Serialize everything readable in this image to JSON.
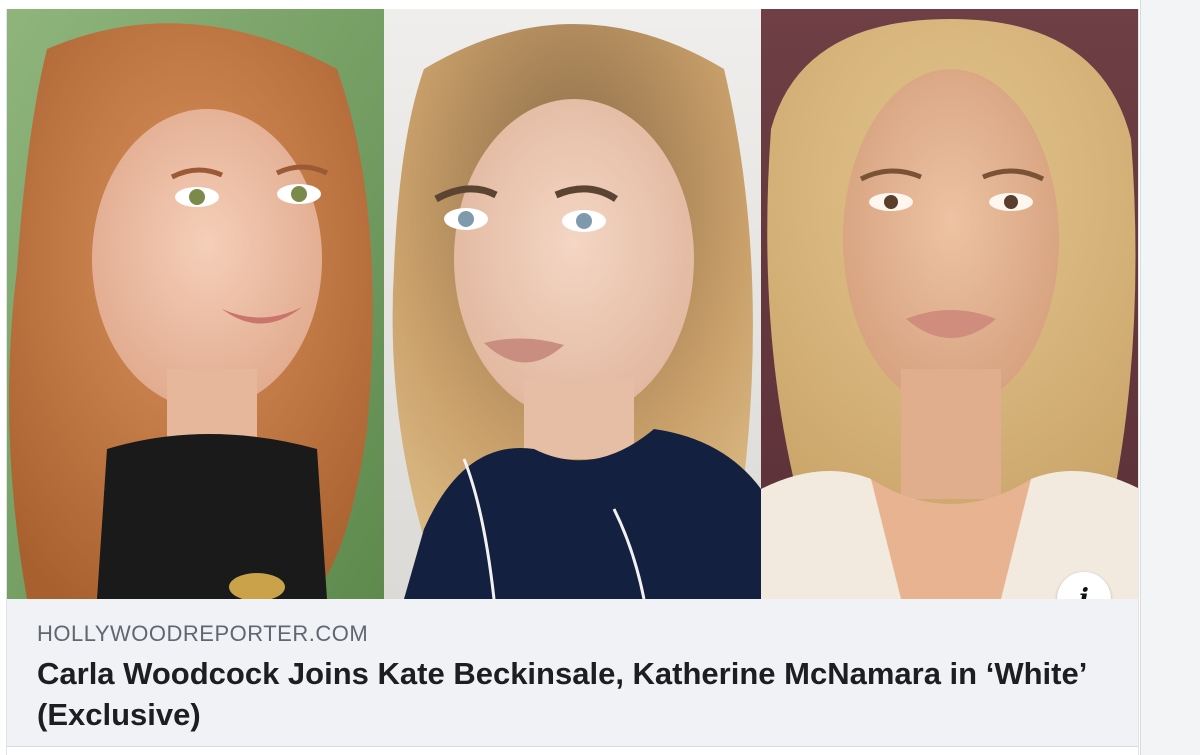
{
  "link_preview": {
    "domain": "HOLLYWOODREPORTER.COM",
    "headline": "Carla Woodcock Joins Kate Beckinsale, Katherine McNamara in ‘White’ (Exclusive)",
    "info_icon": "info-icon",
    "info_glyph": "i"
  },
  "colors": {
    "card_background": "#f0f2f5",
    "domain_text": "#606770",
    "headline_text": "#1c1e21"
  }
}
